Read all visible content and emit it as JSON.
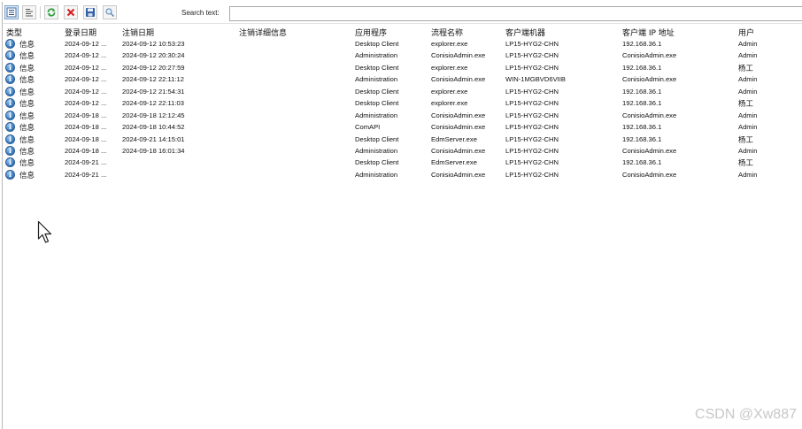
{
  "toolbar": {
    "search_label": "Search text:",
    "search_value": ""
  },
  "columns": [
    "类型",
    "登录日期",
    "注销日期",
    "注销详细信息",
    "应用程序",
    "流程名称",
    "客户端机器",
    "客户端 IP 地址",
    "用户"
  ],
  "rows": [
    {
      "type": "信息",
      "login": "2024-09-12 ...",
      "logout": "2024-09-12 10:53:23",
      "details": "",
      "app": "Desktop Client",
      "process": "explorer.exe",
      "machine": "LP15-HYG2-CHN",
      "ip": "192.168.36.1",
      "user": "Admin"
    },
    {
      "type": "信息",
      "login": "2024-09-12 ...",
      "logout": "2024-09-12 20:30:24",
      "details": "",
      "app": "Administration",
      "process": "ConisioAdmin.exe",
      "machine": "LP15-HYG2-CHN",
      "ip": "ConisioAdmin.exe",
      "user": "Admin"
    },
    {
      "type": "信息",
      "login": "2024-09-12 ...",
      "logout": "2024-09-12 20:27:59",
      "details": "",
      "app": "Desktop Client",
      "process": "explorer.exe",
      "machine": "LP15-HYG2-CHN",
      "ip": "192.168.36.1",
      "user": "杨工"
    },
    {
      "type": "信息",
      "login": "2024-09-12 ...",
      "logout": "2024-09-12 22:11:12",
      "details": "",
      "app": "Administration",
      "process": "ConisioAdmin.exe",
      "machine": "WIN-1MGBVD6VIIB",
      "ip": "ConisioAdmin.exe",
      "user": "Admin"
    },
    {
      "type": "信息",
      "login": "2024-09-12 ...",
      "logout": "2024-09-12 21:54:31",
      "details": "",
      "app": "Desktop Client",
      "process": "explorer.exe",
      "machine": "LP15-HYG2-CHN",
      "ip": "192.168.36.1",
      "user": "Admin"
    },
    {
      "type": "信息",
      "login": "2024-09-12 ...",
      "logout": "2024-09-12 22:11:03",
      "details": "",
      "app": "Desktop Client",
      "process": "explorer.exe",
      "machine": "LP15-HYG2-CHN",
      "ip": "192.168.36.1",
      "user": "杨工"
    },
    {
      "type": "信息",
      "login": "2024-09-18 ...",
      "logout": "2024-09-18 12:12:45",
      "details": "",
      "app": "Administration",
      "process": "ConisioAdmin.exe",
      "machine": "LP15-HYG2-CHN",
      "ip": "ConisioAdmin.exe",
      "user": "Admin"
    },
    {
      "type": "信息",
      "login": "2024-09-18 ...",
      "logout": "2024-09-18 10:44:52",
      "details": "",
      "app": "ComAPI",
      "process": "ConisioAdmin.exe",
      "machine": "LP15-HYG2-CHN",
      "ip": "192.168.36.1",
      "user": "Admin"
    },
    {
      "type": "信息",
      "login": "2024-09-18 ...",
      "logout": "2024-09-21 14:15:01",
      "details": "",
      "app": "Desktop Client",
      "process": "EdmServer.exe",
      "machine": "LP15-HYG2-CHN",
      "ip": "192.168.36.1",
      "user": "杨工"
    },
    {
      "type": "信息",
      "login": "2024-09-18 ...",
      "logout": "2024-09-18 16:01:34",
      "details": "",
      "app": "Administration",
      "process": "ConisioAdmin.exe",
      "machine": "LP15-HYG2-CHN",
      "ip": "ConisioAdmin.exe",
      "user": "Admin"
    },
    {
      "type": "信息",
      "login": "2024-09-21 ...",
      "logout": "",
      "details": "",
      "app": "Desktop Client",
      "process": "EdmServer.exe",
      "machine": "LP15-HYG2-CHN",
      "ip": "192.168.36.1",
      "user": "杨工"
    },
    {
      "type": "信息",
      "login": "2024-09-21 ...",
      "logout": "",
      "details": "",
      "app": "Administration",
      "process": "ConisioAdmin.exe",
      "machine": "LP15-HYG2-CHN",
      "ip": "ConisioAdmin.exe",
      "user": "Admin"
    }
  ],
  "watermark": "CSDN @Xw887",
  "icons": {
    "info": "info-icon",
    "details_view": "details-view-icon",
    "list_view": "list-view-icon",
    "refresh": "refresh-icon",
    "delete": "delete-icon",
    "save": "save-icon",
    "find": "find-icon",
    "cursor": "mouse-pointer-icon"
  },
  "colors": {
    "active_button": "#dce9f8",
    "refresh": "#2e9e3a",
    "delete": "#d42020",
    "info": "#3e7fc4"
  }
}
